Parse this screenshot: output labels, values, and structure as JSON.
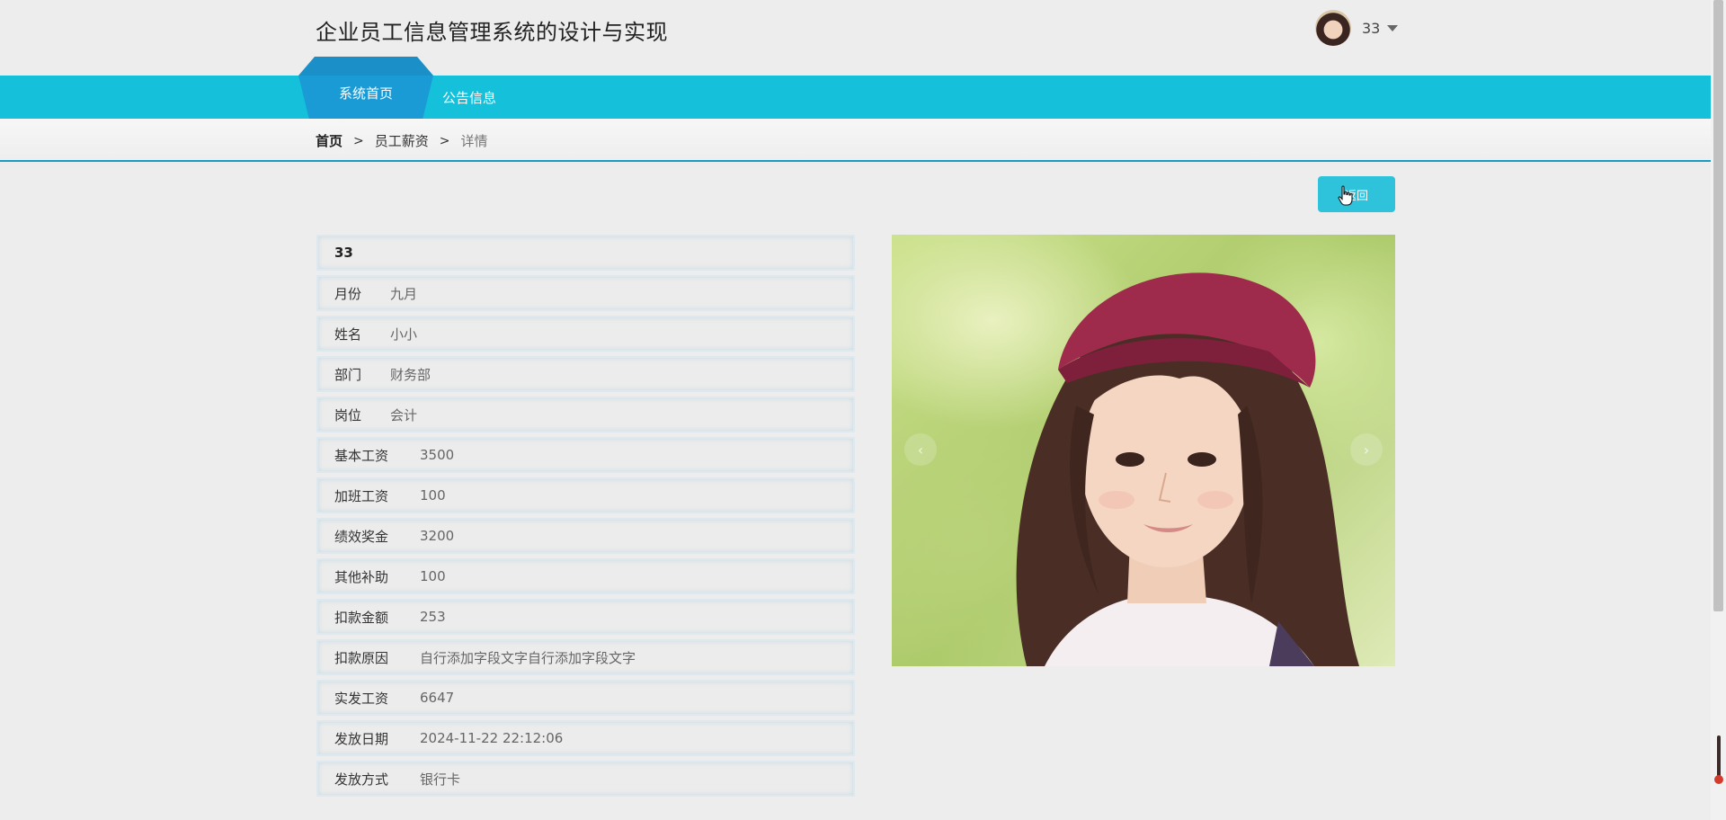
{
  "header": {
    "site_title": "企业员工信息管理系统的设计与实现",
    "user_name": "33"
  },
  "nav": {
    "items": [
      {
        "label": "系统首页",
        "active": true
      },
      {
        "label": "公告信息",
        "active": false
      }
    ]
  },
  "breadcrumb": {
    "home": "首页",
    "middle": "员工薪资",
    "current": "详情",
    "separator": ">"
  },
  "actions": {
    "back_label": "返回"
  },
  "detail": {
    "title": "33",
    "fields": [
      {
        "label": "月份",
        "value": "九月"
      },
      {
        "label": "姓名",
        "value": "小小"
      },
      {
        "label": "部门",
        "value": "财务部"
      },
      {
        "label": "岗位",
        "value": "会计"
      },
      {
        "label": "基本工资",
        "value": "3500"
      },
      {
        "label": "加班工资",
        "value": "100"
      },
      {
        "label": "绩效奖金",
        "value": "3200"
      },
      {
        "label": "其他补助",
        "value": "100"
      },
      {
        "label": "扣款金额",
        "value": "253"
      },
      {
        "label": "扣款原因",
        "value": "自行添加字段文字自行添加字段文字"
      },
      {
        "label": "实发工资",
        "value": "6647"
      },
      {
        "label": "发放日期",
        "value": "2024-11-22 22:12:06"
      },
      {
        "label": "发放方式",
        "value": "银行卡"
      }
    ]
  },
  "carousel": {
    "prev_glyph": "‹",
    "next_glyph": "›"
  },
  "colors": {
    "nav_bg": "#14c0da",
    "active_tab": "#1a9bd6",
    "button_bg": "#2fc2db",
    "divider": "#1a9bc4"
  }
}
